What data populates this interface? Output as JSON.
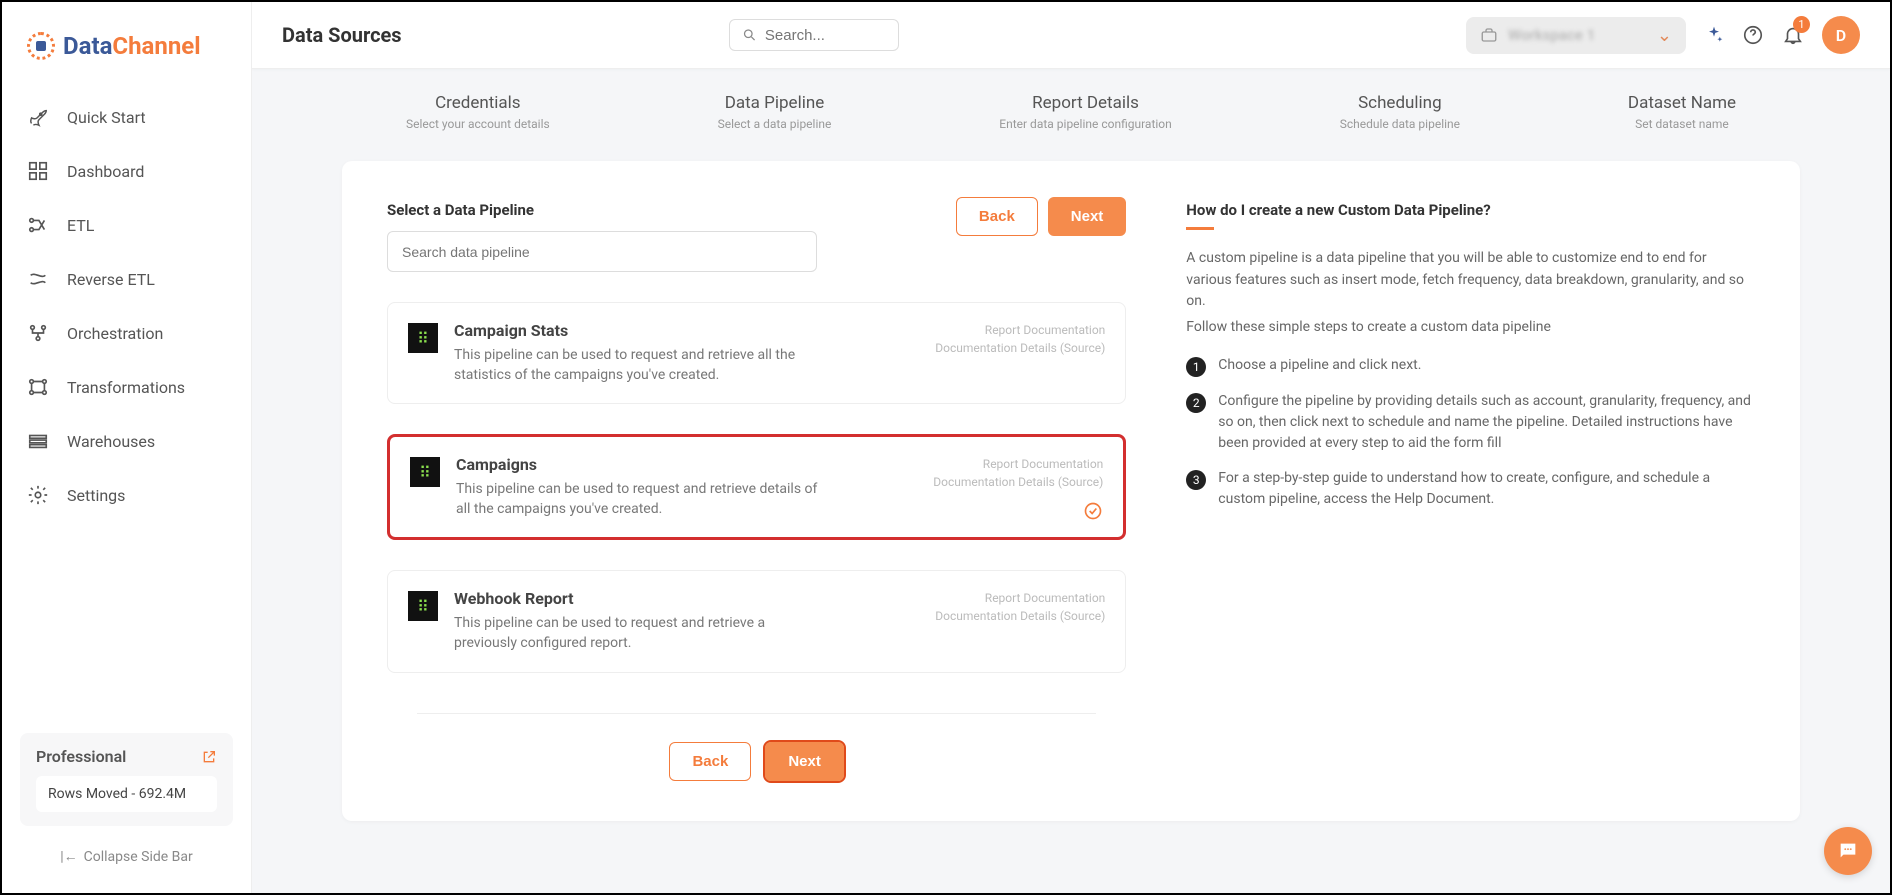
{
  "logo": {
    "part1": "Data",
    "part2": "Channel"
  },
  "sidebar": {
    "items": [
      {
        "label": "Quick Start"
      },
      {
        "label": "Dashboard"
      },
      {
        "label": "ETL"
      },
      {
        "label": "Reverse ETL"
      },
      {
        "label": "Orchestration"
      },
      {
        "label": "Transformations"
      },
      {
        "label": "Warehouses"
      },
      {
        "label": "Settings"
      }
    ],
    "plan": {
      "title": "Professional",
      "rows": "Rows Moved - 692.4M"
    },
    "collapse": "Collapse Side Bar"
  },
  "topbar": {
    "title": "Data Sources",
    "search_placeholder": "Search...",
    "workspace": "Workspace 1",
    "notification_count": "1",
    "avatar": "D"
  },
  "stepper": [
    {
      "title": "Credentials",
      "sub": "Select your account details"
    },
    {
      "title": "Data Pipeline",
      "sub": "Select a data pipeline"
    },
    {
      "title": "Report Details",
      "sub": "Enter data pipeline configuration"
    },
    {
      "title": "Scheduling",
      "sub": "Schedule data pipeline"
    },
    {
      "title": "Dataset Name",
      "sub": "Set dataset name"
    }
  ],
  "panel": {
    "section_title": "Select a Data Pipeline",
    "search_placeholder": "Search data pipeline",
    "back": "Back",
    "next": "Next",
    "pipelines": [
      {
        "title": "Campaign Stats",
        "desc": "This pipeline can be used to request and retrieve all the statistics of the campaigns you've created.",
        "link1": "Report Documentation",
        "link2": "Documentation Details (Source)",
        "selected": false
      },
      {
        "title": "Campaigns",
        "desc": "This pipeline can be used to request and retrieve details of all the campaigns you've created.",
        "link1": "Report Documentation",
        "link2": "Documentation Details (Source)",
        "selected": true
      },
      {
        "title": "Webhook Report",
        "desc": "This pipeline can be used to request and retrieve a previously configured report.",
        "link1": "Report Documentation",
        "link2": "Documentation Details (Source)",
        "selected": false
      }
    ]
  },
  "help": {
    "title": "How do I create a new Custom Data Pipeline?",
    "p1": "A custom pipeline is a data pipeline that you will be able to customize end to end for various features such as insert mode, fetch frequency, data breakdown, granularity, and so on.",
    "p2": "Follow these simple steps to create a custom data pipeline",
    "steps": [
      "Choose a pipeline and click next.",
      "Configure the pipeline by providing details such as account, granularity, frequency, and so on, then click next to schedule and name the pipeline. Detailed instructions have been provided at every step to aid the form fill",
      "For a step-by-step guide to understand how to create, configure, and schedule a custom pipeline, access the Help Document."
    ]
  }
}
